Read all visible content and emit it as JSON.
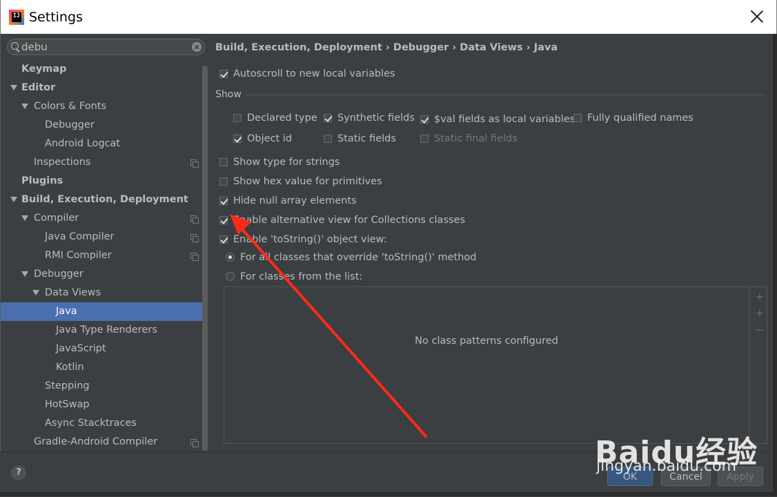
{
  "window": {
    "title": "Settings",
    "app_icon": "intellij-icon",
    "app_icon_text": "IJ"
  },
  "search": {
    "value": "debu",
    "placeholder": ""
  },
  "tree": [
    {
      "label": "Keymap",
      "level": 0,
      "bold": true
    },
    {
      "label": "Editor",
      "level": 0,
      "bold": true,
      "expanded": true
    },
    {
      "label": "Colors & Fonts",
      "level": 1,
      "expanded": true
    },
    {
      "label": "Debugger",
      "level": 2
    },
    {
      "label": "Android Logcat",
      "level": 2
    },
    {
      "label": "Inspections",
      "level": 1,
      "copy": true
    },
    {
      "label": "Plugins",
      "level": 0,
      "bold": true
    },
    {
      "label": "Build, Execution, Deployment",
      "level": 0,
      "bold": true,
      "expanded": true
    },
    {
      "label": "Compiler",
      "level": 1,
      "expanded": true,
      "copy": true
    },
    {
      "label": "Java Compiler",
      "level": 2,
      "copy": true
    },
    {
      "label": "RMI Compiler",
      "level": 2,
      "copy": true
    },
    {
      "label": "Debugger",
      "level": 1,
      "expanded": true
    },
    {
      "label": "Data Views",
      "level": 2,
      "expanded": true
    },
    {
      "label": "Java",
      "level": 3,
      "selected": true
    },
    {
      "label": "Java Type Renderers",
      "level": 3
    },
    {
      "label": "JavaScript",
      "level": 3
    },
    {
      "label": "Kotlin",
      "level": 3
    },
    {
      "label": "Stepping",
      "level": 2
    },
    {
      "label": "HotSwap",
      "level": 2
    },
    {
      "label": "Async Stacktraces",
      "level": 2
    },
    {
      "label": "Gradle-Android Compiler",
      "level": 1,
      "copy": true
    }
  ],
  "breadcrumb": "Build, Execution, Deployment › Debugger › Data Views › Java",
  "options": {
    "autoscroll": {
      "label": "Autoscroll to new local variables",
      "checked": true
    },
    "show_label": "Show",
    "declared_type": {
      "label": "Declared type",
      "checked": false
    },
    "synthetic_fields": {
      "label": "Synthetic fields",
      "checked": true
    },
    "val_fields": {
      "label": "$val fields as local variables",
      "checked": true
    },
    "fully_qualified": {
      "label": "Fully qualified names",
      "checked": false
    },
    "object_id": {
      "label": "Object id",
      "checked": true
    },
    "static_fields": {
      "label": "Static fields",
      "checked": false
    },
    "static_final_fields": {
      "label": "Static final fields",
      "checked": false,
      "disabled": true
    },
    "type_for_strings": {
      "label": "Show type for strings",
      "checked": false
    },
    "hex_primitives": {
      "label": "Show hex value for primitives",
      "checked": false
    },
    "hide_null": {
      "label": "Hide null array elements",
      "checked": true
    },
    "alt_collections": {
      "label": "Enable alternative view for Collections classes",
      "checked": true
    },
    "tostring_view": {
      "label": "Enable 'toString()' object view:",
      "checked": true
    },
    "radio_all": {
      "label": "For all classes that override 'toString()' method",
      "selected": true
    },
    "radio_list": {
      "label": "For classes from the list:",
      "selected": false
    }
  },
  "class_list": {
    "empty_text": "No class patterns configured"
  },
  "buttons": {
    "ok": "OK",
    "cancel": "Cancel",
    "apply": "Apply",
    "help": "?"
  },
  "watermark": {
    "brand": "Baidu经验",
    "url": "jingyan.baidu.com"
  },
  "colors": {
    "selection": "#4b6eaf",
    "panel": "#3c3f41",
    "annotation_arrow": "#ff2a1a"
  }
}
